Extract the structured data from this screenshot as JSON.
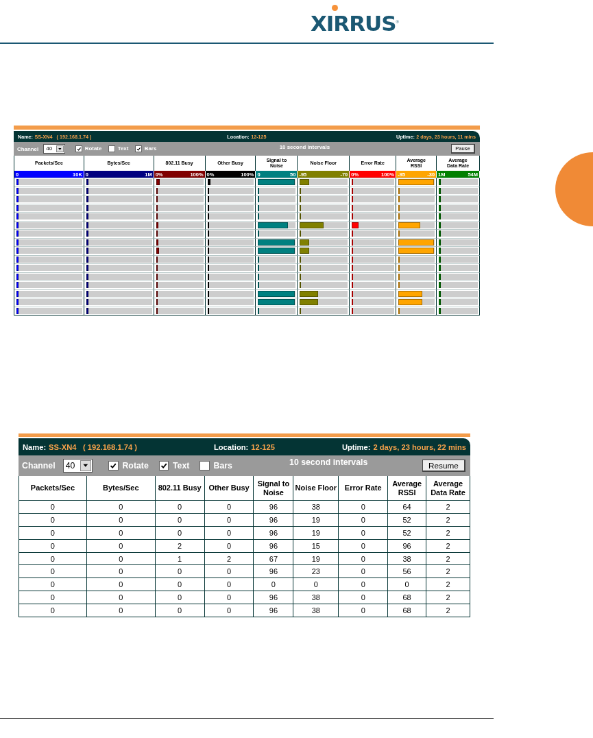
{
  "logo": {
    "text": "XIRRUS",
    "mark": "®"
  },
  "bars_panel": {
    "name_label": "Name:",
    "name": "SS-XN4",
    "ip": "( 192.168.1.74 )",
    "location_label": "Location:",
    "location": "12-125",
    "uptime_label": "Uptime:",
    "uptime": "2 days, 23 hours, 11 mins",
    "channel_label": "Channel",
    "channel": "40",
    "options": [
      {
        "label": "Rotate",
        "checked": true
      },
      {
        "label": "Text",
        "checked": false
      },
      {
        "label": "Bars",
        "checked": true
      }
    ],
    "interval": "10 second intervals",
    "button": "Pause",
    "columns": [
      {
        "label": "Packets/Sec",
        "min": "0",
        "max": "10K",
        "color": "#0000ff"
      },
      {
        "label": "Bytes/Sec",
        "min": "0",
        "max": "1M",
        "color": "#000080"
      },
      {
        "label": "802.11 Busy",
        "min": "0%",
        "max": "100%",
        "color": "#800000"
      },
      {
        "label": "Other Busy",
        "min": "0%",
        "max": "100%",
        "color": "#000000"
      },
      {
        "label": "Signal to\nNoise",
        "min": "0",
        "max": "50",
        "color": "#008080"
      },
      {
        "label": "Noise Floor",
        "min": "-95",
        "max": "-70",
        "color": "#808000"
      },
      {
        "label": "Error Rate",
        "min": "0%",
        "max": "100%",
        "color": "#ff0000"
      },
      {
        "label": "Average\nRSSI",
        "min": "-95",
        "max": "-30",
        "color": "#ffa500"
      },
      {
        "label": "Average\nData Rate",
        "min": "1M",
        "max": "54M",
        "color": "#008000"
      }
    ],
    "rows": [
      {
        "cells": [
          {
            "level": 0.03
          },
          {
            "level": 0.03
          },
          {
            "level": 0.08
          },
          {
            "level": 0.07
          },
          {
            "level": 0.98
          },
          {
            "level": 0.2
          },
          {
            "level": 0.03
          },
          {
            "level": 0.98
          },
          {
            "level": 0.06
          }
        ]
      },
      {
        "cells": [
          {
            "level": 0.03
          },
          {
            "level": 0.03
          },
          {
            "level": 0.04
          },
          {
            "level": 0.03
          },
          {
            "level": 0.03
          },
          {
            "level": 0.03
          },
          {
            "level": 0.03
          },
          {
            "level": 0.03
          },
          {
            "level": 0.05
          }
        ]
      },
      {
        "cells": [
          {
            "level": 0.03
          },
          {
            "level": 0.03
          },
          {
            "level": 0.04
          },
          {
            "level": 0.03
          },
          {
            "level": 0.03
          },
          {
            "level": 0.03
          },
          {
            "level": 0.03
          },
          {
            "level": 0.03
          },
          {
            "level": 0.05
          }
        ]
      },
      {
        "cells": [
          {
            "level": 0.03
          },
          {
            "level": 0.03
          },
          {
            "level": 0.04
          },
          {
            "level": 0.03
          },
          {
            "level": 0.03
          },
          {
            "level": 0.03
          },
          {
            "level": 0.03
          },
          {
            "level": 0.03
          },
          {
            "level": 0.05
          }
        ]
      },
      {
        "cells": [
          {
            "level": 0.03
          },
          {
            "level": 0.03
          },
          {
            "level": 0.04
          },
          {
            "level": 0.03
          },
          {
            "level": 0.03
          },
          {
            "level": 0.03
          },
          {
            "level": 0.03
          },
          {
            "level": 0.03
          },
          {
            "level": 0.06
          }
        ]
      },
      {
        "cells": [
          {
            "level": 0.03
          },
          {
            "level": 0.03
          },
          {
            "level": 0.05
          },
          {
            "level": 0.04
          },
          {
            "level": 0.8
          },
          {
            "level": 0.5
          },
          {
            "level": 0.16
          },
          {
            "level": 0.6
          },
          {
            "level": 0.06
          }
        ]
      },
      {
        "cells": [
          {
            "level": 0.03
          },
          {
            "level": 0.03
          },
          {
            "level": 0.04
          },
          {
            "level": 0.03
          },
          {
            "level": 0.03
          },
          {
            "level": 0.03
          },
          {
            "level": 0.03
          },
          {
            "level": 0.03
          },
          {
            "level": 0.06
          }
        ]
      },
      {
        "cells": [
          {
            "level": 0.03
          },
          {
            "level": 0.03
          },
          {
            "level": 0.05
          },
          {
            "level": 0.03
          },
          {
            "level": 0.98
          },
          {
            "level": 0.19
          },
          {
            "level": 0.03
          },
          {
            "level": 0.98
          },
          {
            "level": 0.06
          }
        ]
      },
      {
        "cells": [
          {
            "level": 0.03
          },
          {
            "level": 0.03
          },
          {
            "level": 0.06
          },
          {
            "level": 0.03
          },
          {
            "level": 0.98
          },
          {
            "level": 0.19
          },
          {
            "level": 0.03
          },
          {
            "level": 0.98
          },
          {
            "level": 0.06
          }
        ]
      },
      {
        "cells": [
          {
            "level": 0.03
          },
          {
            "level": 0.03
          },
          {
            "level": 0.04
          },
          {
            "level": 0.03
          },
          {
            "level": 0.03
          },
          {
            "level": 0.03
          },
          {
            "level": 0.03
          },
          {
            "level": 0.03
          },
          {
            "level": 0.05
          }
        ]
      },
      {
        "cells": [
          {
            "level": 0.03
          },
          {
            "level": 0.03
          },
          {
            "level": 0.04
          },
          {
            "level": 0.04
          },
          {
            "level": 0.03
          },
          {
            "level": 0.03
          },
          {
            "level": 0.03
          },
          {
            "level": 0.03
          },
          {
            "level": 0.06
          }
        ]
      },
      {
        "cells": [
          {
            "level": 0.03
          },
          {
            "level": 0.03
          },
          {
            "level": 0.04
          },
          {
            "level": 0.03
          },
          {
            "level": 0.03
          },
          {
            "level": 0.03
          },
          {
            "level": 0.03
          },
          {
            "level": 0.03
          },
          {
            "level": 0.06
          }
        ]
      },
      {
        "cells": [
          {
            "level": 0.03
          },
          {
            "level": 0.03
          },
          {
            "level": 0.04
          },
          {
            "level": 0.04
          },
          {
            "level": 0.03
          },
          {
            "level": 0.03
          },
          {
            "level": 0.03
          },
          {
            "level": 0.03
          },
          {
            "level": 0.06
          }
        ]
      },
      {
        "cells": [
          {
            "level": 0.03
          },
          {
            "level": 0.03
          },
          {
            "level": 0.04
          },
          {
            "level": 0.03
          },
          {
            "level": 0.98
          },
          {
            "level": 0.38
          },
          {
            "level": 0.03
          },
          {
            "level": 0.65
          },
          {
            "level": 0.06
          }
        ]
      },
      {
        "cells": [
          {
            "level": 0.03
          },
          {
            "level": 0.03
          },
          {
            "level": 0.04
          },
          {
            "level": 0.03
          },
          {
            "level": 0.98
          },
          {
            "level": 0.38
          },
          {
            "level": 0.03
          },
          {
            "level": 0.65
          },
          {
            "level": 0.06
          }
        ]
      },
      {
        "cells": [
          {
            "level": 0.03
          },
          {
            "level": 0.03
          },
          {
            "level": 0.04
          },
          {
            "level": 0.04
          },
          {
            "level": 0.03
          },
          {
            "level": 0.03
          },
          {
            "level": 0.03
          },
          {
            "level": 0.03
          },
          {
            "level": 0.06
          }
        ]
      }
    ]
  },
  "text_panel": {
    "name_label": "Name:",
    "name": "SS-XN4",
    "ip": "( 192.168.1.74 )",
    "location_label": "Location:",
    "location": "12-125",
    "uptime_label": "Uptime:",
    "uptime": "2 days, 23 hours, 22 mins",
    "channel_label": "Channel",
    "channel": "40",
    "options": [
      {
        "label": "Rotate",
        "checked": true
      },
      {
        "label": "Text",
        "checked": true
      },
      {
        "label": "Bars",
        "checked": false
      }
    ],
    "interval": "10 second intervals",
    "button": "Resume",
    "columns": [
      "Packets/Sec",
      "Bytes/Sec",
      "802.11 Busy",
      "Other Busy",
      "Signal to\nNoise",
      "Noise Floor",
      "Error Rate",
      "Average\nRSSI",
      "Average\nData Rate"
    ],
    "rows": [
      [
        "0",
        "0",
        "0",
        "0",
        "96",
        "38",
        "0",
        "64",
        "2"
      ],
      [
        "0",
        "0",
        "0",
        "0",
        "96",
        "19",
        "0",
        "52",
        "2"
      ],
      [
        "0",
        "0",
        "0",
        "0",
        "96",
        "19",
        "0",
        "52",
        "2"
      ],
      [
        "0",
        "0",
        "2",
        "0",
        "96",
        "15",
        "0",
        "96",
        "2"
      ],
      [
        "0",
        "0",
        "1",
        "2",
        "67",
        "19",
        "0",
        "38",
        "2"
      ],
      [
        "0",
        "0",
        "0",
        "0",
        "96",
        "23",
        "0",
        "56",
        "2"
      ],
      [
        "0",
        "0",
        "0",
        "0",
        "0",
        "0",
        "0",
        "0",
        "2"
      ],
      [
        "0",
        "0",
        "0",
        "0",
        "96",
        "38",
        "0",
        "68",
        "2"
      ],
      [
        "0",
        "0",
        "0",
        "0",
        "96",
        "38",
        "0",
        "68",
        "2"
      ]
    ]
  }
}
